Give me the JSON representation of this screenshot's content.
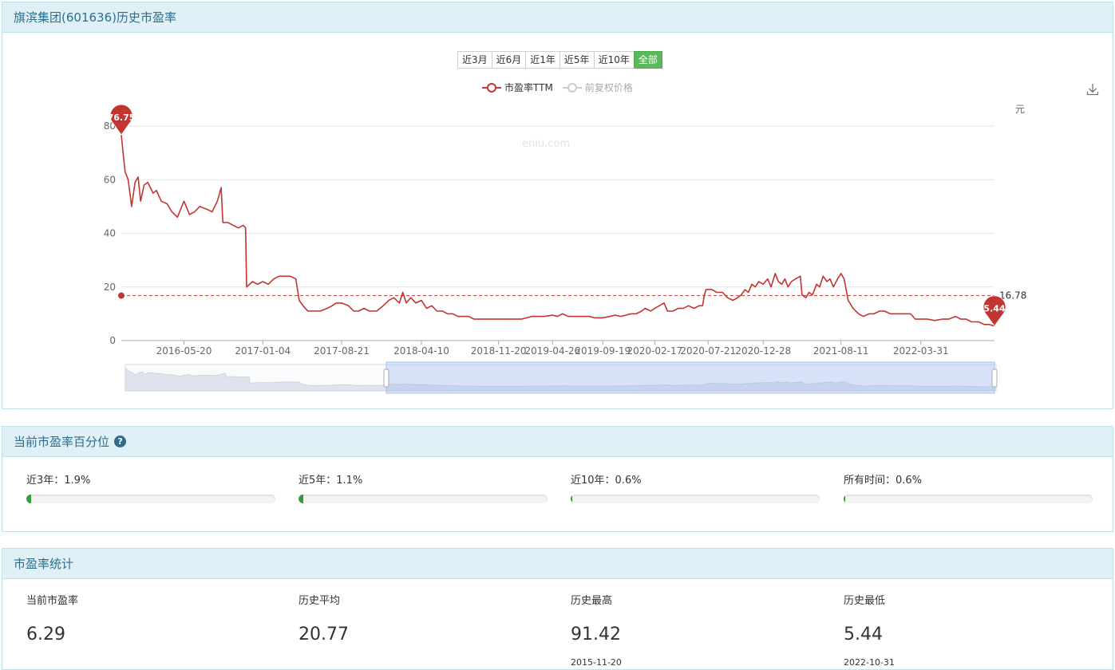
{
  "title": "旗滨集团(601636)历史市盈率",
  "range_buttons": [
    {
      "label": "近3月",
      "active": false
    },
    {
      "label": "近6月",
      "active": false
    },
    {
      "label": "近1年",
      "active": false
    },
    {
      "label": "近5年",
      "active": false
    },
    {
      "label": "近10年",
      "active": false
    },
    {
      "label": "全部",
      "active": true
    }
  ],
  "legend": [
    {
      "label": "市盈率TTM",
      "color": "#c23531",
      "enabled": true
    },
    {
      "label": "前复权价格",
      "color": "#cccccc",
      "enabled": false
    }
  ],
  "unit_label": "元",
  "watermark": "eniu.com",
  "chart_data": {
    "type": "line",
    "series": [
      {
        "name": "市盈率TTM",
        "color": "#c23531"
      }
    ],
    "y_ticks": [
      0,
      20,
      40,
      60,
      80
    ],
    "ylim": [
      0,
      80
    ],
    "x_ticks": [
      "2016-05-20",
      "2017-01-04",
      "2017-08-21",
      "2018-04-10",
      "2018-11-20",
      "2019-04-26",
      "2019-09-19",
      "2020-02-17",
      "2020-07-21",
      "2020-12-28",
      "2021-08-11",
      "2022-03-31"
    ],
    "x_range": [
      "2015-11-20",
      "2022-10-31"
    ],
    "points": [
      [
        "2015-11-20",
        76.75
      ],
      [
        "2015-11-25",
        70
      ],
      [
        "2015-12-01",
        63
      ],
      [
        "2015-12-10",
        60
      ],
      [
        "2015-12-20",
        50
      ],
      [
        "2015-12-30",
        59
      ],
      [
        "2016-01-08",
        61
      ],
      [
        "2016-01-15",
        52
      ],
      [
        "2016-01-25",
        58
      ],
      [
        "2016-02-05",
        59
      ],
      [
        "2016-02-20",
        55
      ],
      [
        "2016-03-01",
        56
      ],
      [
        "2016-03-15",
        52
      ],
      [
        "2016-04-01",
        51
      ],
      [
        "2016-04-15",
        48
      ],
      [
        "2016-05-01",
        46
      ],
      [
        "2016-05-20",
        52
      ],
      [
        "2016-06-05",
        47
      ],
      [
        "2016-06-20",
        48
      ],
      [
        "2016-07-05",
        50
      ],
      [
        "2016-07-25",
        49
      ],
      [
        "2016-08-10",
        48
      ],
      [
        "2016-08-25",
        52
      ],
      [
        "2016-09-05",
        57
      ],
      [
        "2016-09-10",
        44
      ],
      [
        "2016-09-25",
        44
      ],
      [
        "2016-10-10",
        43
      ],
      [
        "2016-10-25",
        42
      ],
      [
        "2016-11-08",
        43
      ],
      [
        "2016-11-15",
        42
      ],
      [
        "2016-11-18",
        20
      ],
      [
        "2016-12-05",
        22
      ],
      [
        "2016-12-20",
        21
      ],
      [
        "2017-01-04",
        22
      ],
      [
        "2017-01-20",
        21
      ],
      [
        "2017-02-05",
        23
      ],
      [
        "2017-02-20",
        24
      ],
      [
        "2017-03-08",
        24
      ],
      [
        "2017-03-25",
        24
      ],
      [
        "2017-04-10",
        23
      ],
      [
        "2017-04-20",
        15
      ],
      [
        "2017-05-01",
        13
      ],
      [
        "2017-05-15",
        11
      ],
      [
        "2017-06-01",
        11
      ],
      [
        "2017-06-20",
        11
      ],
      [
        "2017-07-10",
        12
      ],
      [
        "2017-07-25",
        13
      ],
      [
        "2017-08-05",
        14
      ],
      [
        "2017-08-21",
        14
      ],
      [
        "2017-09-10",
        13
      ],
      [
        "2017-09-25",
        11
      ],
      [
        "2017-10-10",
        11
      ],
      [
        "2017-10-25",
        12
      ],
      [
        "2017-11-10",
        11
      ],
      [
        "2017-12-01",
        11
      ],
      [
        "2017-12-20",
        13
      ],
      [
        "2018-01-05",
        15
      ],
      [
        "2018-01-20",
        16
      ],
      [
        "2018-02-05",
        14
      ],
      [
        "2018-02-15",
        18
      ],
      [
        "2018-02-25",
        14
      ],
      [
        "2018-03-10",
        16
      ],
      [
        "2018-03-25",
        14
      ],
      [
        "2018-04-10",
        15
      ],
      [
        "2018-04-25",
        12
      ],
      [
        "2018-05-10",
        13
      ],
      [
        "2018-05-25",
        11
      ],
      [
        "2018-06-10",
        11
      ],
      [
        "2018-06-25",
        10
      ],
      [
        "2018-07-10",
        10
      ],
      [
        "2018-07-25",
        9
      ],
      [
        "2018-08-10",
        9
      ],
      [
        "2018-08-25",
        9
      ],
      [
        "2018-09-10",
        8
      ],
      [
        "2018-09-25",
        8
      ],
      [
        "2018-10-10",
        8
      ],
      [
        "2018-10-25",
        8
      ],
      [
        "2018-11-20",
        8
      ],
      [
        "2018-12-10",
        8
      ],
      [
        "2018-12-25",
        8
      ],
      [
        "2019-01-10",
        8
      ],
      [
        "2019-01-25",
        8
      ],
      [
        "2019-02-10",
        8.5
      ],
      [
        "2019-02-25",
        9
      ],
      [
        "2019-03-15",
        9
      ],
      [
        "2019-04-01",
        9
      ],
      [
        "2019-04-26",
        9.5
      ],
      [
        "2019-05-10",
        9
      ],
      [
        "2019-05-25",
        10
      ],
      [
        "2019-06-10",
        9
      ],
      [
        "2019-06-25",
        9
      ],
      [
        "2019-07-10",
        9
      ],
      [
        "2019-07-25",
        9
      ],
      [
        "2019-08-10",
        9
      ],
      [
        "2019-08-25",
        8.5
      ],
      [
        "2019-09-19",
        8.5
      ],
      [
        "2019-10-10",
        9
      ],
      [
        "2019-10-25",
        9.5
      ],
      [
        "2019-11-10",
        9
      ],
      [
        "2019-11-25",
        9.5
      ],
      [
        "2019-12-10",
        10
      ],
      [
        "2019-12-25",
        10
      ],
      [
        "2020-01-10",
        11
      ],
      [
        "2020-01-20",
        12
      ],
      [
        "2020-02-05",
        11
      ],
      [
        "2020-02-17",
        12
      ],
      [
        "2020-03-01",
        13
      ],
      [
        "2020-03-15",
        14
      ],
      [
        "2020-03-25",
        11
      ],
      [
        "2020-04-10",
        11
      ],
      [
        "2020-04-25",
        12
      ],
      [
        "2020-05-10",
        12
      ],
      [
        "2020-05-25",
        13
      ],
      [
        "2020-06-10",
        12
      ],
      [
        "2020-06-25",
        13
      ],
      [
        "2020-07-05",
        13
      ],
      [
        "2020-07-10",
        17
      ],
      [
        "2020-07-15",
        19
      ],
      [
        "2020-07-21",
        19
      ],
      [
        "2020-08-01",
        19
      ],
      [
        "2020-08-15",
        18
      ],
      [
        "2020-09-01",
        18
      ],
      [
        "2020-09-15",
        16
      ],
      [
        "2020-10-01",
        15
      ],
      [
        "2020-10-15",
        16
      ],
      [
        "2020-10-25",
        17
      ],
      [
        "2020-11-05",
        19
      ],
      [
        "2020-11-15",
        18
      ],
      [
        "2020-11-25",
        21
      ],
      [
        "2020-12-05",
        20
      ],
      [
        "2020-12-15",
        22
      ],
      [
        "2020-12-28",
        21
      ],
      [
        "2021-01-10",
        23
      ],
      [
        "2021-01-20",
        20
      ],
      [
        "2021-02-01",
        25
      ],
      [
        "2021-02-10",
        22
      ],
      [
        "2021-02-20",
        21
      ],
      [
        "2021-03-01",
        23
      ],
      [
        "2021-03-10",
        20
      ],
      [
        "2021-03-20",
        22
      ],
      [
        "2021-04-01",
        23
      ],
      [
        "2021-04-15",
        24
      ],
      [
        "2021-04-20",
        17
      ],
      [
        "2021-05-01",
        16
      ],
      [
        "2021-05-10",
        18
      ],
      [
        "2021-05-20",
        17
      ],
      [
        "2021-06-01",
        21
      ],
      [
        "2021-06-10",
        20
      ],
      [
        "2021-06-20",
        24
      ],
      [
        "2021-07-01",
        22
      ],
      [
        "2021-07-10",
        23
      ],
      [
        "2021-07-20",
        20
      ],
      [
        "2021-08-01",
        23
      ],
      [
        "2021-08-11",
        25
      ],
      [
        "2021-08-20",
        23
      ],
      [
        "2021-09-01",
        15
      ],
      [
        "2021-09-15",
        12
      ],
      [
        "2021-10-01",
        10
      ],
      [
        "2021-10-15",
        9
      ],
      [
        "2021-11-01",
        10
      ],
      [
        "2021-11-15",
        10
      ],
      [
        "2021-12-01",
        11
      ],
      [
        "2021-12-15",
        11
      ],
      [
        "2022-01-01",
        10
      ],
      [
        "2022-01-20",
        10
      ],
      [
        "2022-02-10",
        10
      ],
      [
        "2022-03-01",
        10
      ],
      [
        "2022-03-15",
        8
      ],
      [
        "2022-03-31",
        8
      ],
      [
        "2022-04-20",
        8
      ],
      [
        "2022-05-10",
        7.5
      ],
      [
        "2022-06-01",
        8
      ],
      [
        "2022-06-20",
        8
      ],
      [
        "2022-07-10",
        9
      ],
      [
        "2022-07-25",
        8
      ],
      [
        "2022-08-10",
        8
      ],
      [
        "2022-08-25",
        7
      ],
      [
        "2022-09-15",
        7
      ],
      [
        "2022-10-01",
        6
      ],
      [
        "2022-10-15",
        6
      ],
      [
        "2022-10-31",
        5.44
      ]
    ],
    "markers": [
      {
        "label": "76.75",
        "date": "2015-11-20",
        "value": 76.75
      },
      {
        "label": "5.44",
        "date": "2022-10-31",
        "value": 5.44
      }
    ],
    "average_line": {
      "label": "16.78",
      "value": 16.78
    }
  },
  "percentile": {
    "title": "当前市盈率百分位",
    "help_icon": "question-circle-icon",
    "items": [
      {
        "label": "近3年：1.9%",
        "value": 1.9
      },
      {
        "label": "近5年：1.1%",
        "value": 1.1
      },
      {
        "label": "近10年：0.6%",
        "value": 0.6
      },
      {
        "label": "所有时间：0.6%",
        "value": 0.6
      }
    ]
  },
  "stats": {
    "title": "市盈率统计",
    "items": [
      {
        "label": "当前市盈率",
        "value": "6.29",
        "date": ""
      },
      {
        "label": "历史平均",
        "value": "20.77",
        "date": ""
      },
      {
        "label": "历史最高",
        "value": "91.42",
        "date": "2015-11-20"
      },
      {
        "label": "历史最低",
        "value": "5.44",
        "date": "2022-10-31"
      }
    ]
  }
}
